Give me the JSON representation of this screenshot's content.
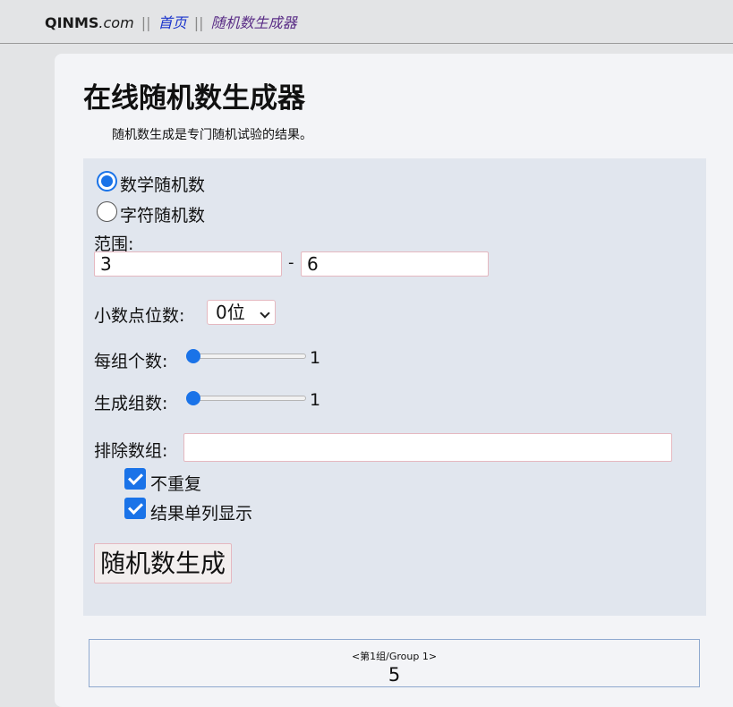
{
  "breadcrumb": {
    "brand_bold": "QINMS",
    "brand_italic": ".com",
    "separator": "||",
    "home": "首页",
    "current": "随机数生成器"
  },
  "page": {
    "title": "在线随机数生成器",
    "subtitle": "随机数生成是专门随机试验的结果。"
  },
  "form": {
    "mode_options": [
      {
        "label": "数学随机数",
        "checked": true
      },
      {
        "label": "字符随机数",
        "checked": false
      }
    ],
    "range": {
      "label": "范围:",
      "min_value": "3",
      "dash": "-",
      "max_value": "6"
    },
    "decimals": {
      "label": "小数点位数:",
      "selected": "0位"
    },
    "per_group": {
      "label": "每组个数:",
      "value": "1",
      "fraction": 0.0
    },
    "group_count": {
      "label": "生成组数:",
      "value": "1",
      "fraction": 0.0
    },
    "exclude": {
      "label": "排除数组:",
      "value": ""
    },
    "options": [
      {
        "label": "不重复",
        "checked": true
      },
      {
        "label": "结果单列显示",
        "checked": true
      }
    ],
    "generate_label": "随机数生成"
  },
  "result": {
    "header": "<第1组/Group 1>",
    "value": "5"
  },
  "colors": {
    "accent": "#1a73e8",
    "panel": "#e1e6ee",
    "card": "#f3f4f7",
    "input_border": "#e5b8c0",
    "link": "#1a33cc",
    "visited": "#5a2d86"
  }
}
